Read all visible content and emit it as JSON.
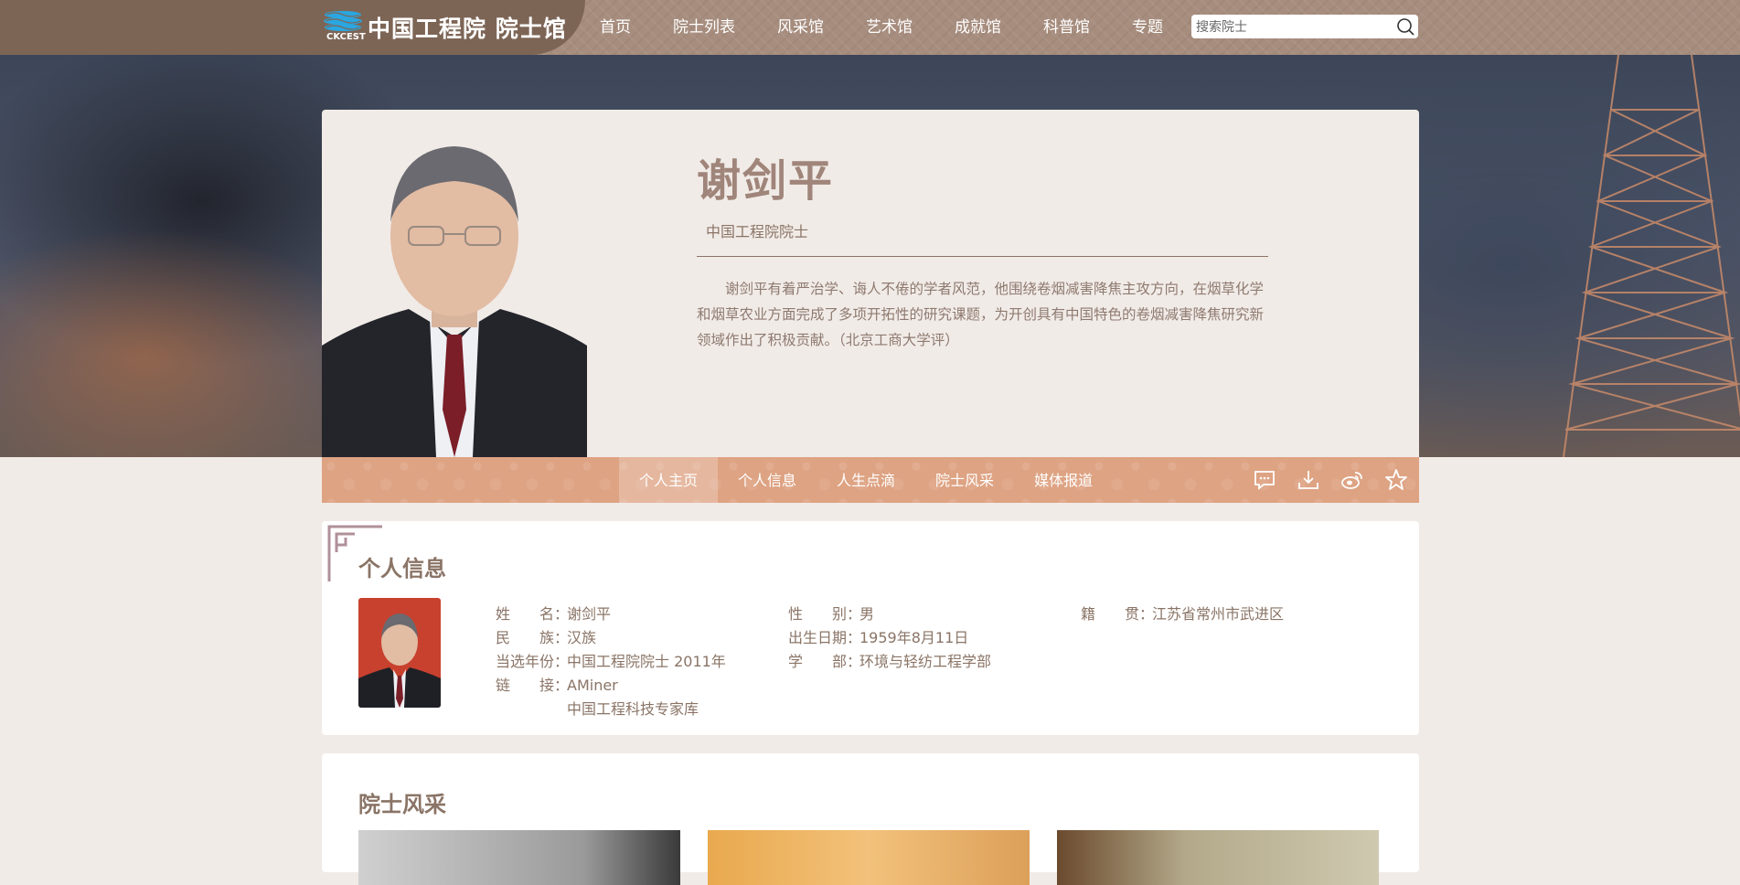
{
  "header": {
    "logo_text": "中国工程院",
    "logo_hall": "院士馆",
    "logo_sub": "CKCEST",
    "nav": [
      "首页",
      "院士列表",
      "风采馆",
      "艺术馆",
      "成就馆",
      "科普馆",
      "专题"
    ],
    "search_placeholder": "搜索院士"
  },
  "profile": {
    "name": "谢剑平",
    "title": "中国工程院院士",
    "bio": "谢剑平有着严治学、诲人不倦的学者风范，他围绕卷烟减害降焦主攻方向，在烟草化学和烟草农业方面完成了多项开拓性的研究课题，为开创具有中国特色的卷烟减害降焦研究新领域作出了积极贡献。（北京工商大学评）"
  },
  "tabs": [
    "个人主页",
    "个人信息",
    "人生点滴",
    "院士风采",
    "媒体报道"
  ],
  "tab_icons": [
    "comment-icon",
    "download-icon",
    "weibo-icon",
    "star-icon"
  ],
  "info": {
    "section_title": "个人信息",
    "name_label": "姓　　名：",
    "name_value": "谢剑平",
    "ethnic_label": "民　　族：",
    "ethnic_value": "汉族",
    "elected_label": "当选年份：",
    "elected_value": "中国工程院院士 2011年",
    "link_label": "链　　接：",
    "link_1": "AMiner",
    "link_2": "中国工程科技专家库",
    "gender_label": "性　　别：",
    "gender_value": "男",
    "birth_label": "出生日期：",
    "birth_value": "1959年8月11日",
    "dept_label": "学　　部：",
    "dept_value": "环境与轻纺工程学部",
    "native_label": "籍　　贯：",
    "native_value": "江苏省常州市武进区"
  },
  "gallery": {
    "title": "院士风采"
  },
  "colors": {
    "nav_bg": "#a78d7e",
    "logo_bg": "#7d6556",
    "tab_bar": "#dea383",
    "text_brown": "#8a7466",
    "page_bg": "#f1ebe7"
  }
}
